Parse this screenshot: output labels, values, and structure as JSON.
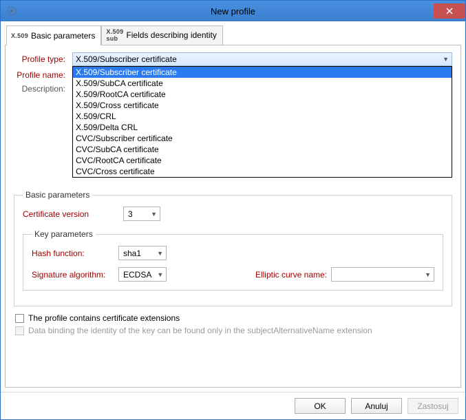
{
  "window": {
    "title": "New profile"
  },
  "tabs": {
    "basic": "Basic parameters",
    "fields": "Fields describing identity"
  },
  "form": {
    "profile_type_label": "Profile type:",
    "profile_type_value": "X.509/Subscriber certificate",
    "profile_name_label": "Profile name:",
    "description_label": "Description:"
  },
  "profile_type_options": [
    "X.509/Subscriber certificate",
    "X.509/SubCA certificate",
    "X.509/RootCA certificate",
    "X.509/Cross certificate",
    "X.509/CRL",
    "X.509/Delta CRL",
    "CVC/Subscriber certificate",
    "CVC/SubCA certificate",
    "CVC/RootCA certificate",
    "CVC/Cross certificate"
  ],
  "basic": {
    "legend": "Basic parameters",
    "cert_version_label": "Certificate version",
    "cert_version_value": "3",
    "key_params_legend": "Key parameters",
    "hash_label": "Hash function:",
    "hash_value": "sha1",
    "sig_label": "Signature algorithm:",
    "sig_value": "ECDSA",
    "curve_label": "Elliptic curve name:",
    "curve_value": ""
  },
  "checks": {
    "extensions": "The profile contains certificate extensions",
    "binding": "Data binding the identity of the key can be found only in the subjectAlternativeName extension"
  },
  "buttons": {
    "ok": "OK",
    "cancel": "Anuluj",
    "apply": "Zastosuj"
  }
}
